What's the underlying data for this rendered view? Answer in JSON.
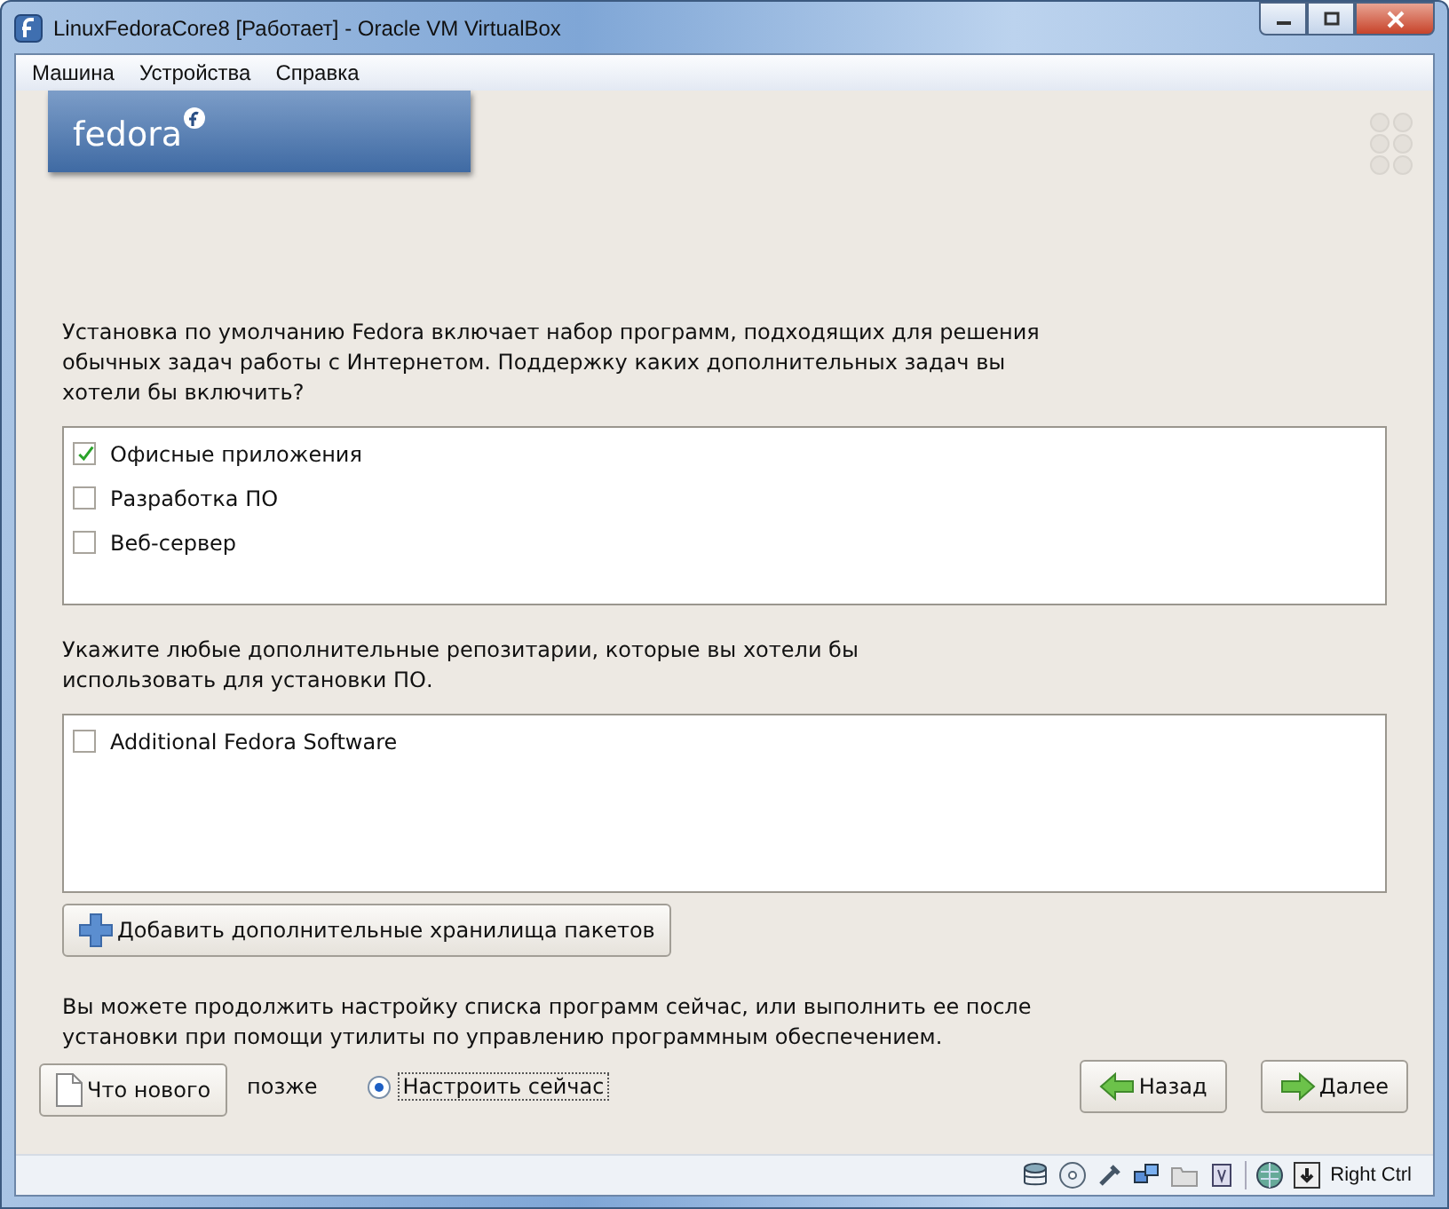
{
  "window": {
    "title": "LinuxFedoraCore8 [Работает] - Oracle VM VirtualBox"
  },
  "menu": [
    "Машина",
    "Устройства",
    "Справка"
  ],
  "logo_text": "fedora",
  "intro": "Установка по умолчанию Fedora включает набор программ, подходящих для решения обычных задач работы с Интернетом.  Поддержку каких дополнительных задач вы хотели бы включить?",
  "tasks": [
    {
      "label": "Офисные приложения",
      "checked": true
    },
    {
      "label": "Разработка ПО",
      "checked": false
    },
    {
      "label": "Веб-сервер",
      "checked": false
    }
  ],
  "repos_text": "Укажите любые дополнительные репозитарии, которые вы хотели бы использовать для установки ПО.",
  "repos": [
    {
      "label": "Additional Fedora Software",
      "checked": false
    }
  ],
  "add_button": "Добавить дополнительные хранилища пакетов",
  "customize_text": "Вы можете продолжить настройку списка программ сейчас, или выполнить ее после установки при помощи утилиты по управлению программным обеспечением.",
  "radio_partial_label": "позже",
  "radio": {
    "label": "Настроить сейчас",
    "selected": true
  },
  "release_notes_button": "Что нового",
  "back_button": "Назад",
  "next_button": "Далее",
  "status_bar": {
    "host_key": "Right Ctrl"
  }
}
